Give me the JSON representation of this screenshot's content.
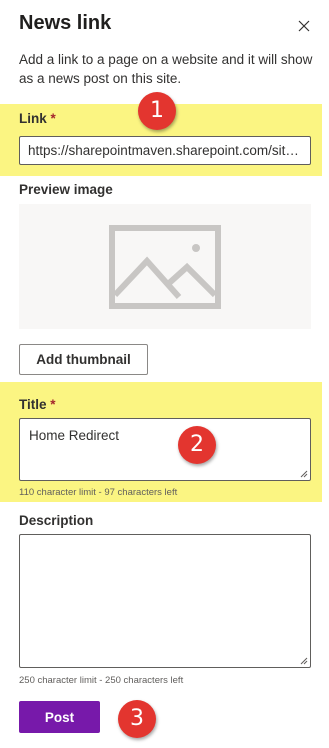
{
  "panel": {
    "title": "News link",
    "description": "Add a link to a page on a website and it will show as a news post on this site."
  },
  "link": {
    "label": "Link",
    "required_mark": "*",
    "value": "https://sharepointmaven.sharepoint.com/sites/..."
  },
  "preview": {
    "label": "Preview image",
    "add_thumbnail_label": "Add thumbnail"
  },
  "title_field": {
    "label": "Title",
    "required_mark": "*",
    "value": "Home Redirect",
    "hint": "110 character limit - 97 characters left"
  },
  "description_field": {
    "label": "Description",
    "value": "",
    "hint": "250 character limit - 250 characters left"
  },
  "actions": {
    "post_label": "Post"
  },
  "annotations": {
    "badge1": "1",
    "badge2": "2",
    "badge3": "3"
  },
  "colors": {
    "highlight": "#fbf582",
    "accent": "#7719aa",
    "badge": "#e3352f",
    "required": "#a4262c"
  },
  "icons": {
    "close": "close-icon",
    "image_placeholder": "image-placeholder-icon",
    "resize_grip": "resize-grip-icon"
  }
}
